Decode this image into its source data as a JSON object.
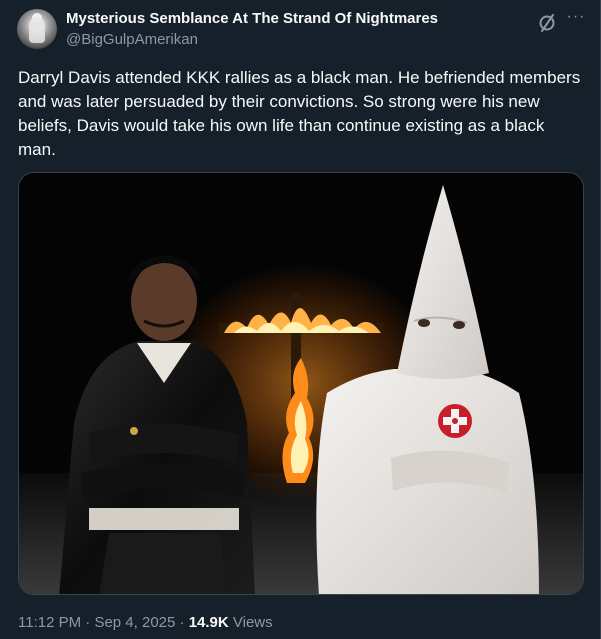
{
  "author": {
    "display_name": "Mysterious Semblance At The Strand Of Nightmares",
    "handle": "@BigGulpAmerikan",
    "avatar_icon": "statue-avatar"
  },
  "actions": {
    "grok_icon": "grok-icon",
    "more_icon": "more-options-icon",
    "more_glyph": "···"
  },
  "tweet": {
    "text": "Darryl Davis attended KKK rallies as a black man. He befriended members and was later persuaded by their convictions. So strong were his new beliefs, Davis would take his own life than continue existing as a black man."
  },
  "media": {
    "type": "photo"
  },
  "meta": {
    "time": "11:12 PM",
    "sep1": " · ",
    "date": "Sep 4, 2025",
    "sep2": " · ",
    "views_count": "14.9K",
    "views_label": " Views"
  },
  "colors": {
    "background": "#15202b",
    "text_primary": "#f7f9f9",
    "text_secondary": "#8b98a5",
    "border": "#38444d"
  }
}
